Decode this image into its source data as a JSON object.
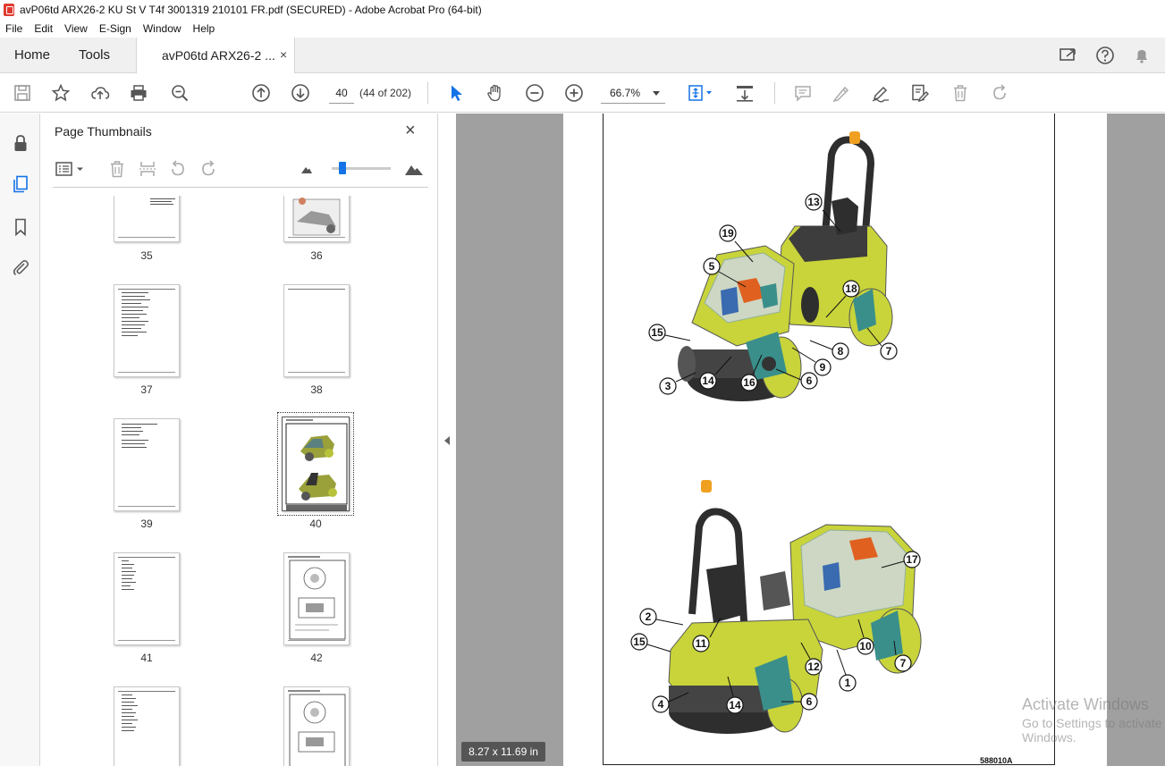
{
  "window": {
    "title": "avP06td ARX26-2 KU St V T4f 3001319 210101 FR.pdf (SECURED) - Adobe Acrobat Pro (64-bit)"
  },
  "menu": [
    "File",
    "Edit",
    "View",
    "E-Sign",
    "Window",
    "Help"
  ],
  "tabs": {
    "home": "Home",
    "tools": "Tools",
    "document": "avP06td ARX26-2 ...",
    "close": "×"
  },
  "toolbar": {
    "page_number": "40",
    "page_count": "(44 of 202)",
    "zoom": "66.7%"
  },
  "panel": {
    "title": "Page Thumbnails",
    "close": "×",
    "selected_page": "40",
    "thumbnails": [
      {
        "label": "35"
      },
      {
        "label": "36"
      },
      {
        "label": "37"
      },
      {
        "label": "38"
      },
      {
        "label": "39"
      },
      {
        "label": "40"
      },
      {
        "label": "41"
      },
      {
        "label": "42"
      }
    ]
  },
  "document": {
    "figure_code": "588010A",
    "callouts_top": [
      "13",
      "19",
      "5",
      "18",
      "15",
      "8",
      "7",
      "9",
      "3",
      "14",
      "16",
      "6"
    ],
    "callouts_bottom": [
      "17",
      "2",
      "11",
      "15",
      "10",
      "12",
      "7",
      "1",
      "4",
      "14",
      "6"
    ]
  },
  "page_size": "8.27 x 11.69 in",
  "watermark": {
    "line1": "Activate Windows",
    "line2": "Go to Settings to activate Windows."
  },
  "colors": {
    "accent": "#1473e6",
    "machine_green": "#c8d43a",
    "machine_dark": "#2e2e2e",
    "machine_teal": "#3a8f8a",
    "beacon": "#f0a020",
    "doc_background": "#a0a0a0"
  }
}
